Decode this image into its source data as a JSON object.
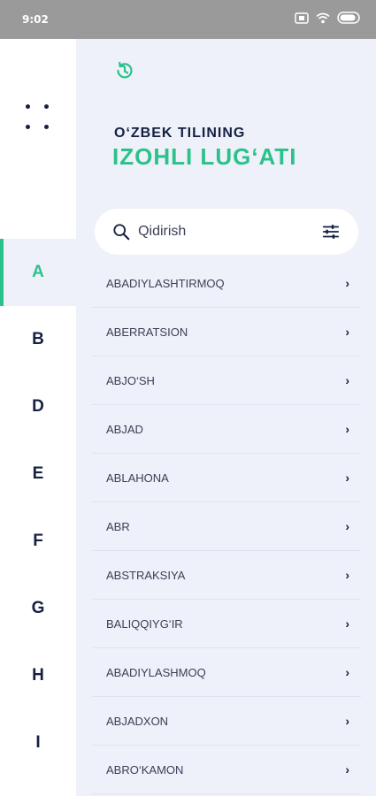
{
  "status_bar": {
    "time": "9:02",
    "icons": [
      "screen-record-icon",
      "wifi-icon",
      "toggle-icon"
    ]
  },
  "sidebar": {
    "menu_icon": "grid-dots-icon",
    "letters": [
      "A",
      "B",
      "D",
      "E",
      "F",
      "G",
      "H",
      "I"
    ],
    "active_letter": "A"
  },
  "header": {
    "history_icon": "history-icon",
    "title_line1": "O‘ZBEK TILINING",
    "title_line2": "IZOHLI LUG‘ATI"
  },
  "search": {
    "placeholder": "Qidirish",
    "value": ""
  },
  "words": [
    "ABADIYLASHTIRMOQ",
    "ABERRATSION",
    "ABJO‘SH",
    "ABJAD",
    "ABLAHONA",
    "ABR",
    "ABSTRAKSIYA",
    "BALIQQIYG‘IR",
    "ABADIYLASHMOQ",
    "ABJADXON",
    "ABRO‘KAMON"
  ],
  "colors": {
    "accent": "#2bc28a",
    "dark": "#152042",
    "background": "#eef1f9"
  }
}
